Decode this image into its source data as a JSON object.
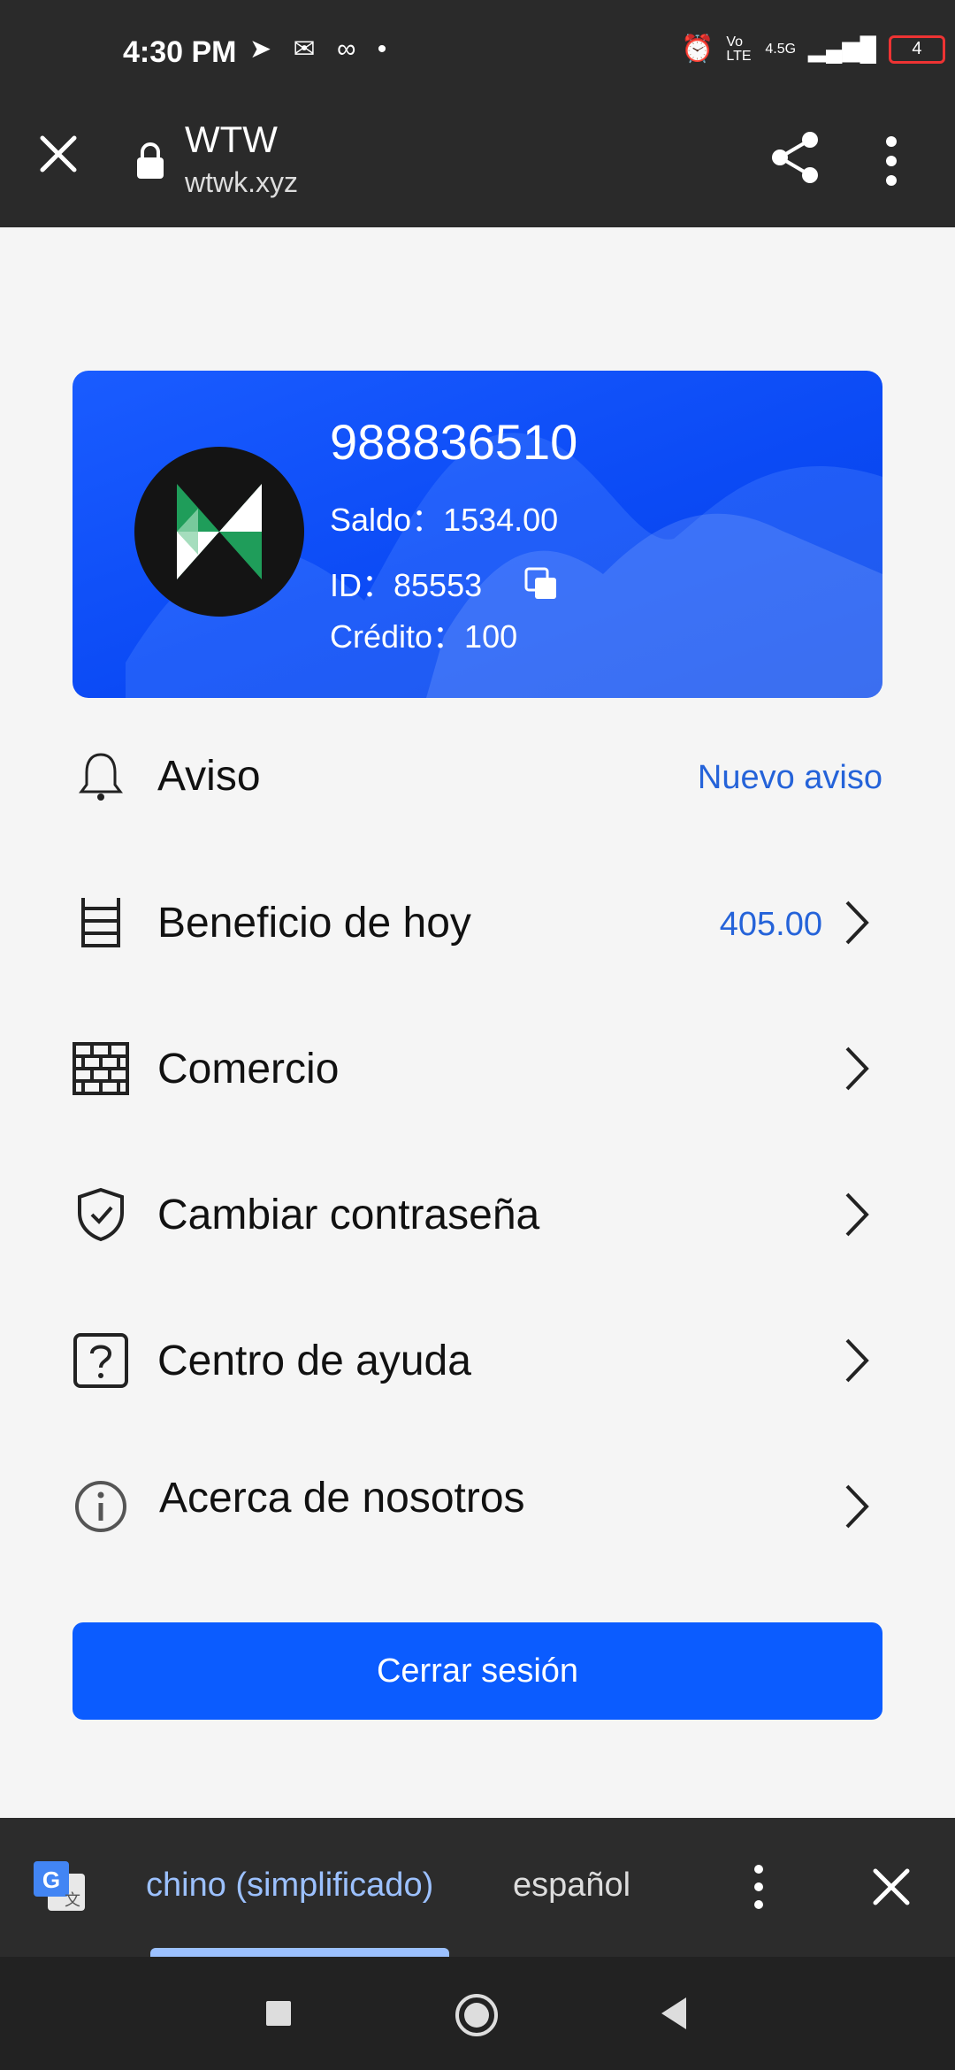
{
  "status_bar": {
    "time": "4:30 PM",
    "network": "4.5G",
    "volte": "Vo LTE",
    "battery": "4",
    "icons": [
      "telegram-icon",
      "outlook-icon",
      "voicemail-icon",
      "dot-icon",
      "alarm-icon",
      "volte-icon",
      "signal-icon",
      "battery-icon"
    ]
  },
  "browser": {
    "title": "WTW",
    "url": "wtwk.xyz"
  },
  "profile": {
    "phone": "988836510",
    "balance_line": "Saldo：1534.00",
    "id_line": "ID：85553",
    "credit_line": "Crédito：100"
  },
  "menu": {
    "notice": {
      "label": "Aviso",
      "value": "Nuevo aviso"
    },
    "profit": {
      "label": "Beneficio de hoy",
      "value": "405.00"
    },
    "commerce": {
      "label": "Comercio"
    },
    "password": {
      "label": "Cambiar contraseña"
    },
    "help": {
      "label": "Centro de ayuda"
    },
    "about": {
      "label": "Acerca de nosotros"
    }
  },
  "logout_label": "Cerrar sesión",
  "translate": {
    "source_lang": "chino (simplificado)",
    "target_lang": "español"
  },
  "colors": {
    "accent": "#0b5cff",
    "link": "#2563d9",
    "chrome": "#2a2a2a"
  }
}
